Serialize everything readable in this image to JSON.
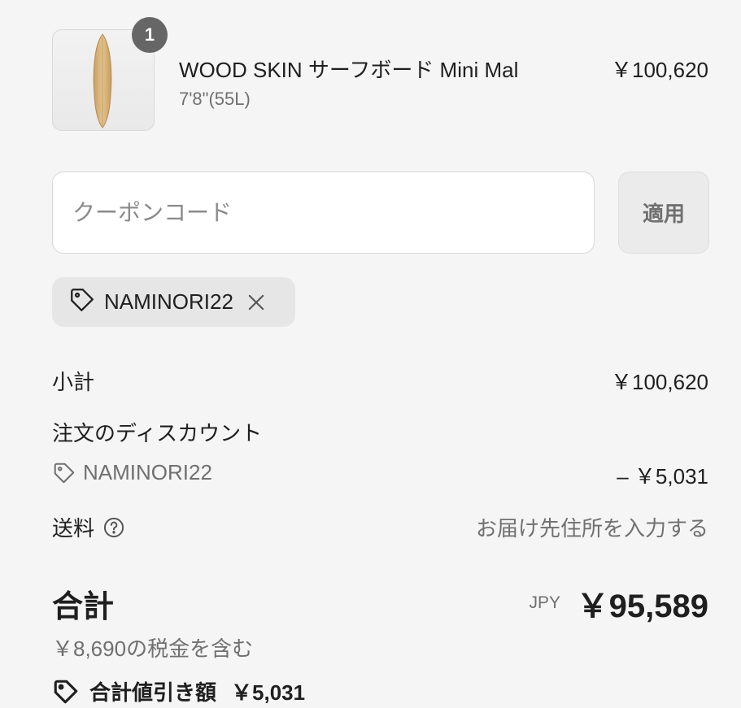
{
  "line_item": {
    "quantity": "1",
    "title": "WOOD SKIN サーフボード Mini Mal",
    "variant": "7'8\"(55L)",
    "price": "￥100,620"
  },
  "discount_form": {
    "placeholder": "クーポンコード",
    "value": "",
    "apply_label": "適用"
  },
  "applied_code": {
    "code": "NAMINORI22"
  },
  "summary": {
    "subtotal_label": "小計",
    "subtotal_value": "￥100,620",
    "discount_label": "注文のディスカウント",
    "discount_code": "NAMINORI22",
    "discount_value": "– ￥5,031",
    "shipping_label": "送料",
    "shipping_value": "お届け先住所を入力する"
  },
  "total": {
    "label": "合計",
    "currency": "JPY",
    "value": "￥95,589",
    "tax_note": "￥8,690の税金を含む",
    "savings_label": "合計値引き額",
    "savings_value": "￥5,031"
  },
  "icons": [
    "tag-icon",
    "close-icon",
    "help-circle-icon"
  ]
}
